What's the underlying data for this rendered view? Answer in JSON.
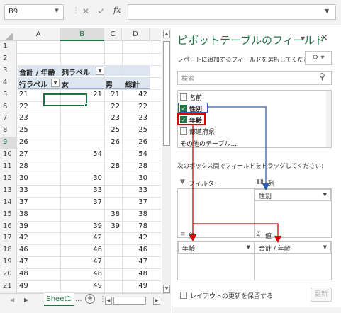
{
  "formula_bar": {
    "name_box": "B9",
    "cancel_glyph": "✕",
    "enter_glyph": "✓",
    "fx_label": "fx",
    "value": ""
  },
  "grid": {
    "columns": [
      "A",
      "B",
      "C",
      "D"
    ],
    "selected_column": "B",
    "rows": [
      "1",
      "2",
      "3",
      "4",
      "5",
      "6",
      "7",
      "8",
      "9",
      "10",
      "11",
      "12",
      "13",
      "14",
      "15",
      "16",
      "17",
      "18",
      "19",
      "20",
      "21"
    ],
    "selected_row": "9",
    "pivot_header_row3": {
      "a": "合計 / 年齢",
      "b": "列ラベル"
    },
    "pivot_header_row4": {
      "a": "行ラベル",
      "b": "女",
      "c": "男",
      "d": "総計"
    },
    "data_rows": [
      {
        "row": "5",
        "label": "21",
        "f": "21",
        "m": "21",
        "t": "42"
      },
      {
        "row": "6",
        "label": "22",
        "f": "",
        "m": "22",
        "t": "22"
      },
      {
        "row": "7",
        "label": "23",
        "f": "",
        "m": "23",
        "t": "23"
      },
      {
        "row": "8",
        "label": "25",
        "f": "",
        "m": "25",
        "t": "25"
      },
      {
        "row": "9",
        "label": "26",
        "f": "",
        "m": "26",
        "t": "26"
      },
      {
        "row": "10",
        "label": "27",
        "f": "54",
        "m": "",
        "t": "54"
      },
      {
        "row": "11",
        "label": "28",
        "f": "",
        "m": "28",
        "t": "28"
      },
      {
        "row": "12",
        "label": "30",
        "f": "30",
        "m": "",
        "t": "30"
      },
      {
        "row": "13",
        "label": "33",
        "f": "33",
        "m": "",
        "t": "33"
      },
      {
        "row": "14",
        "label": "37",
        "f": "37",
        "m": "",
        "t": "37"
      },
      {
        "row": "15",
        "label": "38",
        "f": "",
        "m": "38",
        "t": "38"
      },
      {
        "row": "16",
        "label": "39",
        "f": "39",
        "m": "39",
        "t": "78"
      },
      {
        "row": "17",
        "label": "42",
        "f": "42",
        "m": "",
        "t": "42"
      },
      {
        "row": "18",
        "label": "46",
        "f": "46",
        "m": "",
        "t": "46"
      },
      {
        "row": "19",
        "label": "47",
        "f": "47",
        "m": "",
        "t": "47"
      },
      {
        "row": "20",
        "label": "48",
        "f": "48",
        "m": "",
        "t": "48"
      },
      {
        "row": "21",
        "label": "49",
        "f": "49",
        "m": "",
        "t": "49"
      }
    ]
  },
  "sheet_tabs": {
    "active": "Sheet1",
    "more": "...",
    "add": "⊕"
  },
  "pivot_pane": {
    "title": "ピボットテーブルのフィールド",
    "subtitle": "レポートに追加するフィールドを選択してください:",
    "search_placeholder": "検索",
    "fields": [
      {
        "label": "名前",
        "checked": false
      },
      {
        "label": "性別",
        "checked": true
      },
      {
        "label": "年齢",
        "checked": true
      },
      {
        "label": "都道府県",
        "checked": false
      }
    ],
    "more_tables": "その他のテーブル...",
    "drag_hint": "次のボックス間でフィールドをドラッグしてください:",
    "zones": {
      "filters": {
        "title": "フィルター",
        "chip": ""
      },
      "columns": {
        "title": "列",
        "chip": "性別"
      },
      "rows": {
        "title": "行",
        "chip": "年齢"
      },
      "values": {
        "title": "値",
        "chip": "合計 / 年齢"
      }
    },
    "defer_label": "レイアウトの更新を保留する",
    "update_button": "更新"
  },
  "colors": {
    "accent_green": "#217346",
    "annotation_red": "#e00000",
    "annotation_blue": "#2e5fb3",
    "pivot_header_fill": "#dce6f1"
  }
}
